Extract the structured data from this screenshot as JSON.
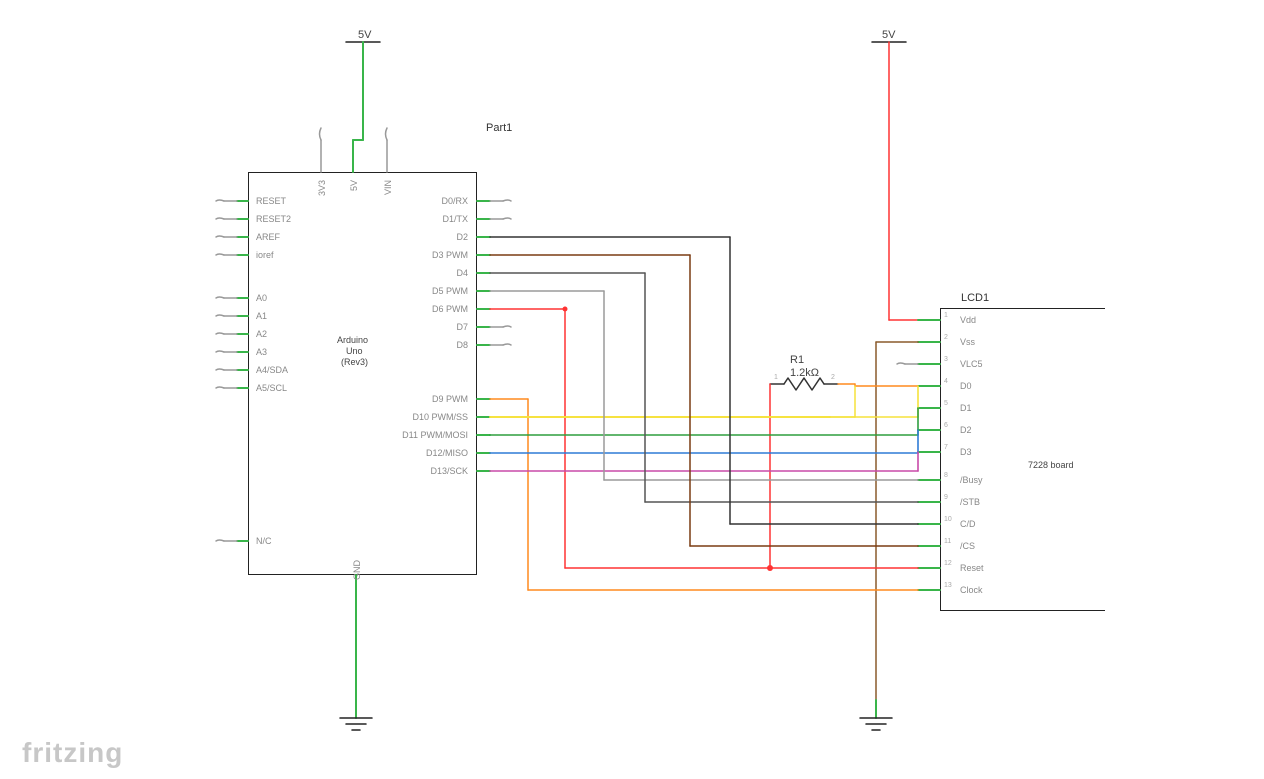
{
  "meta": {
    "tool": "fritzing"
  },
  "power": {
    "arduino_rail": "5V",
    "lcd_rail": "5V"
  },
  "part1": {
    "title": "Part1",
    "name_line1": "Arduino",
    "name_line2": "Uno",
    "name_line3": "(Rev3)",
    "left_pins": [
      "RESET",
      "RESET2",
      "AREF",
      "ioref",
      "A0",
      "A1",
      "A2",
      "A3",
      "A4/SDA",
      "A5/SCL",
      "N/C"
    ],
    "top_pins": [
      "3V3",
      "5V",
      "VIN"
    ],
    "right_pins": [
      "D0/RX",
      "D1/TX",
      "D2",
      "D3 PWM",
      "D4",
      "D5 PWM",
      "D6 PWM",
      "D7",
      "D8",
      "D9 PWM",
      "D10 PWM/SS",
      "D11 PWM/MOSI",
      "D12/MISO",
      "D13/SCK"
    ],
    "bottom_pin": "GND"
  },
  "resistor": {
    "ref": "R1",
    "value": "1.2kΩ",
    "pin_left": "1",
    "pin_right": "2"
  },
  "lcd": {
    "title": "LCD1",
    "name": "7228 board",
    "pins": [
      {
        "n": "1",
        "label": "Vdd"
      },
      {
        "n": "2",
        "label": "Vss"
      },
      {
        "n": "3",
        "label": "VLC5"
      },
      {
        "n": "4",
        "label": "D0"
      },
      {
        "n": "5",
        "label": "D1"
      },
      {
        "n": "6",
        "label": "D2"
      },
      {
        "n": "7",
        "label": "D3"
      },
      {
        "n": "8",
        "label": "/Busy"
      },
      {
        "n": "9",
        "label": "/STB"
      },
      {
        "n": "10",
        "label": "C/D"
      },
      {
        "n": "11",
        "label": "/CS"
      },
      {
        "n": "12",
        "label": "Reset"
      },
      {
        "n": "13",
        "label": "Clock"
      }
    ]
  },
  "connections_note": "Wiring: 5V→Arduino 5V; 5V→LCD Vdd (via R1 branch to Reset); D2→C/D; D3→/CS; D4→/STB; D5→/Busy; D6→Reset; D9→Clock; D10→D0; D11→D1; D12→D2; D13→D3; GND symbols on Arduino GND and LCD Vss."
}
